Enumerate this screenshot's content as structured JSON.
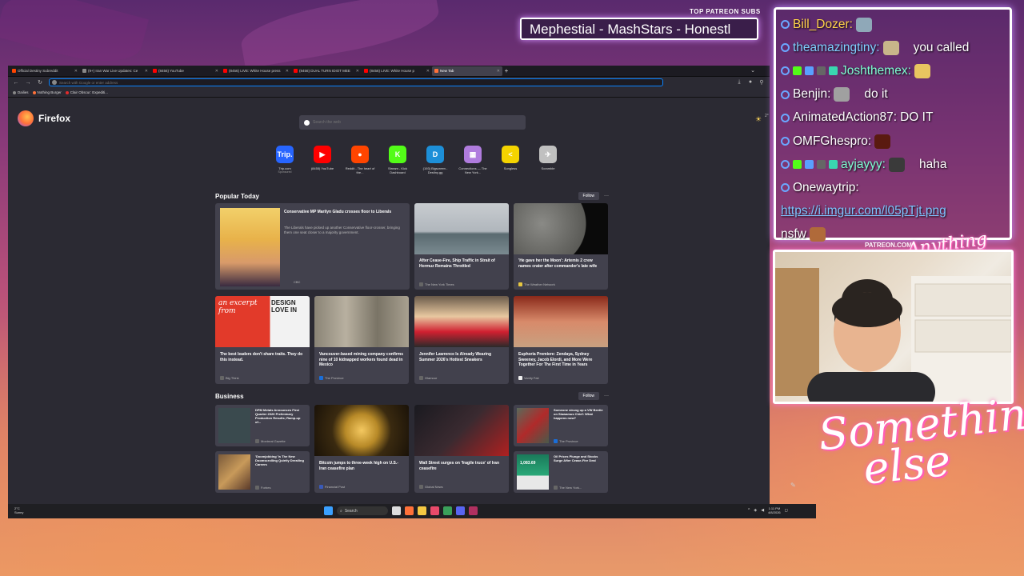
{
  "overlay": {
    "patreon_label": "TOP PATREON SUBS",
    "ticker_text": "Mephestial - MashStars - Honestl",
    "patreon_com": "PATREON.COM/"
  },
  "browser": {
    "tabs": [
      {
        "label": "Official Destiny Subreddit",
        "color": "#ff4500",
        "active": false
      },
      {
        "label": "(9+) Iran War Live Updates: Ce",
        "color": "#888888",
        "active": false
      },
      {
        "label": "(8456) YouTube",
        "color": "#ff0000",
        "active": false
      },
      {
        "label": "(8456) LIVE: White House press",
        "color": "#ff0000",
        "active": false
      },
      {
        "label": "(8456) DUAL TURN IDIOT MEE",
        "color": "#ff0000",
        "active": false
      },
      {
        "label": "(8456) LIVE: White House p",
        "color": "#ff0000",
        "active": false
      },
      {
        "label": "New Tab",
        "color": "#ff7139",
        "active": true
      }
    ],
    "url_placeholder": "Search with Google or enter address",
    "bookmarks": [
      {
        "label": "Dailies",
        "color": "#888888"
      },
      {
        "label": "Nothing Burger",
        "color": "#ff7139"
      },
      {
        "label": "Clair Obscur: Expediti...",
        "color": "#e22b2b"
      }
    ]
  },
  "newtab": {
    "brand": "Firefox",
    "weather_temp": "2°",
    "search_placeholder": "Search the web",
    "shortcuts": [
      {
        "label": "Trip.com",
        "sub": "Sponsored",
        "icon_text": "Trip.",
        "color": "#2765ff"
      },
      {
        "label": "(8455) YouTube",
        "sub": "",
        "icon_text": "▶",
        "color": "#ff0000"
      },
      {
        "label": "Reddit - The heart of the...",
        "sub": "",
        "icon_text": "●",
        "color": "#ff4500"
      },
      {
        "label": "Stream - Kick Dashboard",
        "sub": "",
        "icon_text": "K",
        "color": "#53fc18"
      },
      {
        "label": "(193) Bigscreen - Destiny.gg",
        "sub": "",
        "icon_text": "D",
        "color": "#1d8fd8"
      },
      {
        "label": "Connections — The New York...",
        "sub": "",
        "icon_text": "▦",
        "color": "#b07cde"
      },
      {
        "label": "Songless",
        "sub": "",
        "icon_text": "<",
        "color": "#f5d400"
      },
      {
        "label": "Scramble",
        "sub": "",
        "icon_text": "✈",
        "color": "#c0c0c0"
      }
    ],
    "popular_title": "Popular Today",
    "business_title": "Business",
    "follow_label": "Follow",
    "popular_cards": [
      {
        "title": "Conservative MP Marilyn Gladu crosses floor to Liberals",
        "desc": "The Liberals have picked up another Conservative floor-crosser, bringing them one seat closer to a majority government.",
        "source": "CBC"
      },
      {
        "title": "After Cease-Fire, Ship Traffic in Strait of Hormuz Remains Throttled",
        "source": "The New York Times"
      },
      {
        "title": "'He gave her the Moon': Artemis 2 crew names crater after commander's late wife",
        "source": "The Weather Network"
      },
      {
        "title": "The best leaders don't share traits. They do this instead.",
        "source": "Big Think",
        "img_text": "an excerpt from",
        "img_text2": "DESIGN LOVE IN"
      },
      {
        "title": "Vancouver-based mining company confirms nine of 10 kidnapped workers found dead in Mexico",
        "source": "The Province"
      },
      {
        "title": "Jennifer Lawrence Is Already Wearing Summer 2026's Hottest Sneakers",
        "source": "Glamour"
      },
      {
        "title": "Euphoria Premiere: Zendaya, Sydney Sweeney, Jacob Elordi, and More Were Together For The First Time in Years",
        "source": "Vanity Fair"
      }
    ],
    "business_cards": [
      {
        "title": "DPM Metals Announces First Quarter 2026 Preliminary Production Results; Ramp-up of...",
        "source": "Montreal Gazette"
      },
      {
        "title": "Bitcoin jumps to three-week high on U.S.-Iran ceasefire plan",
        "source": "Financial Post"
      },
      {
        "title": "Wall Street surges on 'fragile truce' of Iran ceasefire",
        "source": "Global News"
      },
      {
        "title": "Someone strung up a VW Beetle on Slawamus Chief: What happens now?",
        "source": "The Province"
      },
      {
        "title": "'Doomjobbing' Is The New Doomscrolling Quietly Derailing Careers",
        "source": "Forbes"
      },
      {
        "title": "Oil Prices Plunge and Stocks Surge After Cease-Fire Deal",
        "source": "The New York...",
        "img_text": "1,083.69"
      }
    ]
  },
  "taskbar": {
    "weather": "2°C",
    "weather_desc": "Sunny",
    "search_label": "Search",
    "time": "1:11 PM",
    "date": "4/8/2026"
  },
  "chat": [
    {
      "user": "Bill_Dozer:",
      "text": "",
      "color": "#ffd24a",
      "emote": "#8fa8b8"
    },
    {
      "user": "theamazingtiny:",
      "text": "you called",
      "color": "#7fd0ff",
      "emote": "#c8b58a"
    },
    {
      "user": "Joshthemex:",
      "text": "",
      "color": "#7fffd4",
      "emote": "#e8c560",
      "badges": true
    },
    {
      "user": "Benjin:",
      "text": "do it",
      "color": "#ffffff",
      "emote": "#a0a0a0"
    },
    {
      "user": "AnimatedAction87:",
      "text": "DO IT",
      "color": "#ffffff"
    },
    {
      "user": "OMFGhespro:",
      "text": "",
      "color": "#ffffff",
      "emote": "#5a1a10"
    },
    {
      "user": "ayjayyy:",
      "text": "haha",
      "color": "#7fffd4",
      "emote": "#3a3a3a",
      "badges": true
    },
    {
      "user": "Onewaytrip:",
      "text": "",
      "color": "#ffffff"
    }
  ],
  "chat_link": "https://i.imgur.com/l05pTjt.png",
  "chat_tail": "nsfw",
  "signatures": {
    "anything_else": "Anything else",
    "something_else": "Something else"
  }
}
